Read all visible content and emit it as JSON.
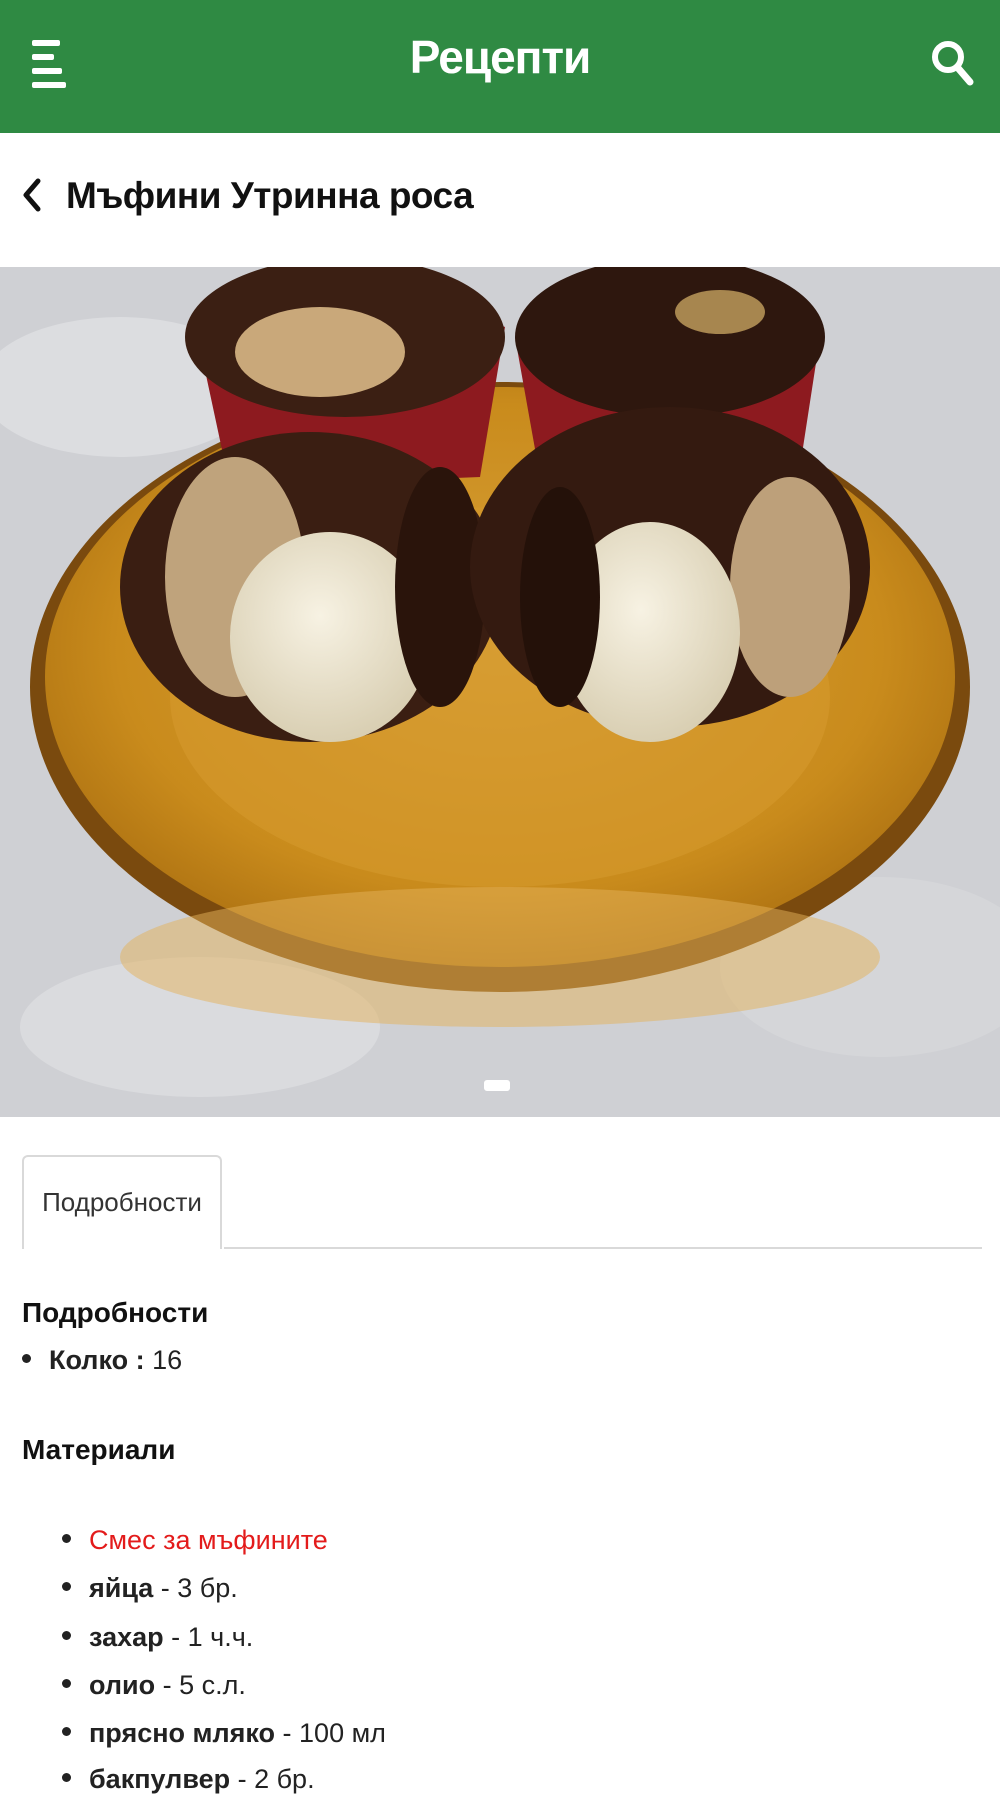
{
  "appbar": {
    "title": "Рецепти",
    "color": "#2f8a43"
  },
  "recipe": {
    "title": "Мъфини Утринна роса"
  },
  "tabs": [
    {
      "label": "Подробности"
    }
  ],
  "details": {
    "heading": "Подробности",
    "items": [
      {
        "label": "Колко",
        "sep": " : ",
        "value": "16"
      }
    ]
  },
  "materials": {
    "heading": "Материали",
    "group_title": "Смес за мъфините",
    "items": [
      {
        "name": "яйца",
        "qty": " - 3 бр."
      },
      {
        "name": "захар",
        "qty": " - 1 ч.ч."
      },
      {
        "name": "олио",
        "qty": " - 5 с.л."
      },
      {
        "name": "прясно мляко",
        "qty": " - 100 мл"
      },
      {
        "name": "бакпулвер",
        "qty": " - 2 бр."
      }
    ]
  }
}
